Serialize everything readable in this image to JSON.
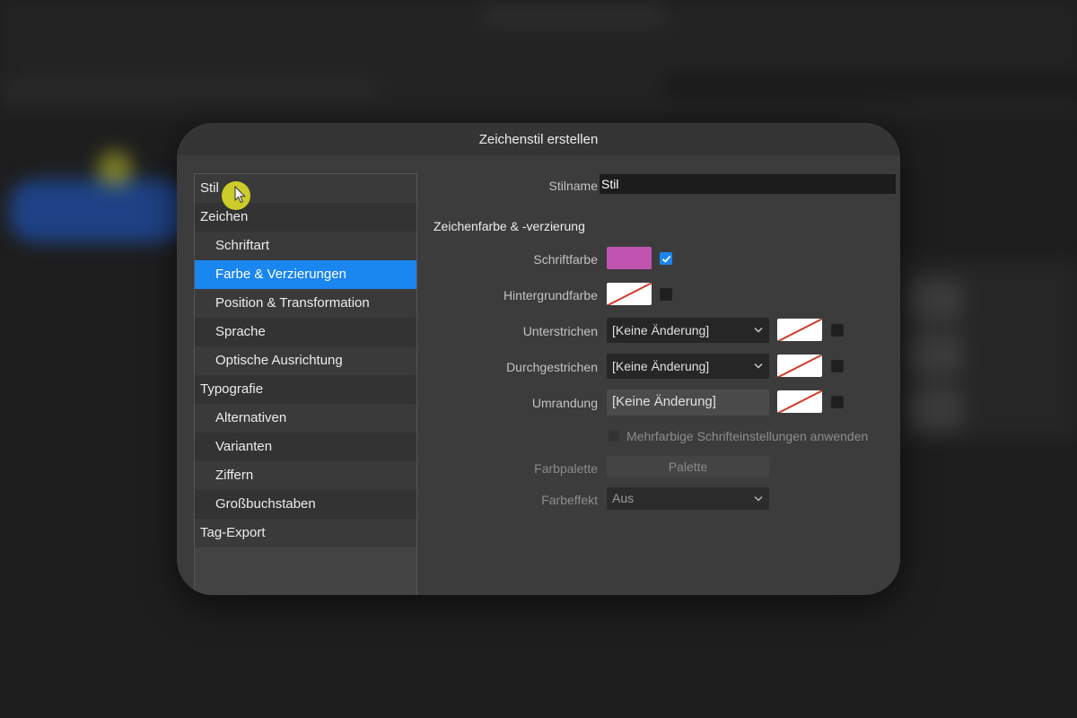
{
  "dialog": {
    "title": "Zeichenstil erstellen"
  },
  "categories": [
    {
      "label": "Stil",
      "level": 0
    },
    {
      "label": "Zeichen",
      "level": 0
    },
    {
      "label": "Schriftart",
      "level": 1
    },
    {
      "label": "Farbe & Verzierungen",
      "level": 1,
      "selected": true
    },
    {
      "label": "Position & Transformation",
      "level": 1
    },
    {
      "label": "Sprache",
      "level": 1
    },
    {
      "label": "Optische Ausrichtung",
      "level": 1
    },
    {
      "label": "Typografie",
      "level": 0
    },
    {
      "label": "Alternativen",
      "level": 1
    },
    {
      "label": "Varianten",
      "level": 1
    },
    {
      "label": "Ziffern",
      "level": 1
    },
    {
      "label": "Großbuchstaben",
      "level": 1
    },
    {
      "label": "Tag-Export",
      "level": 0
    }
  ],
  "form": {
    "stilname_label": "Stilname",
    "stilname_value": "Stil",
    "section_title": "Zeichenfarbe & -verzierung",
    "schriftfarbe_label": "Schriftfarbe",
    "schriftfarbe_color": "#c054b0",
    "schriftfarbe_checked": true,
    "hintergrundfarbe_label": "Hintergrundfarbe",
    "unterstrichen_label": "Unterstrichen",
    "unterstrichen_value": "[Keine Änderung]",
    "durchgestrichen_label": "Durchgestrichen",
    "durchgestrichen_value": "[Keine Änderung]",
    "umrandung_label": "Umrandung",
    "umrandung_value": "[Keine Änderung]",
    "mehrfarbig_label": "Mehrfarbige Schrifteinstellungen anwenden",
    "farbpalette_label": "Farbpalette",
    "palette_button": "Palette",
    "farbeffekt_label": "Farbeffekt",
    "farbeffekt_value": "Aus"
  },
  "colors": {
    "accent": "#1a86f0",
    "swatch_none_line": "#d23a2a"
  }
}
